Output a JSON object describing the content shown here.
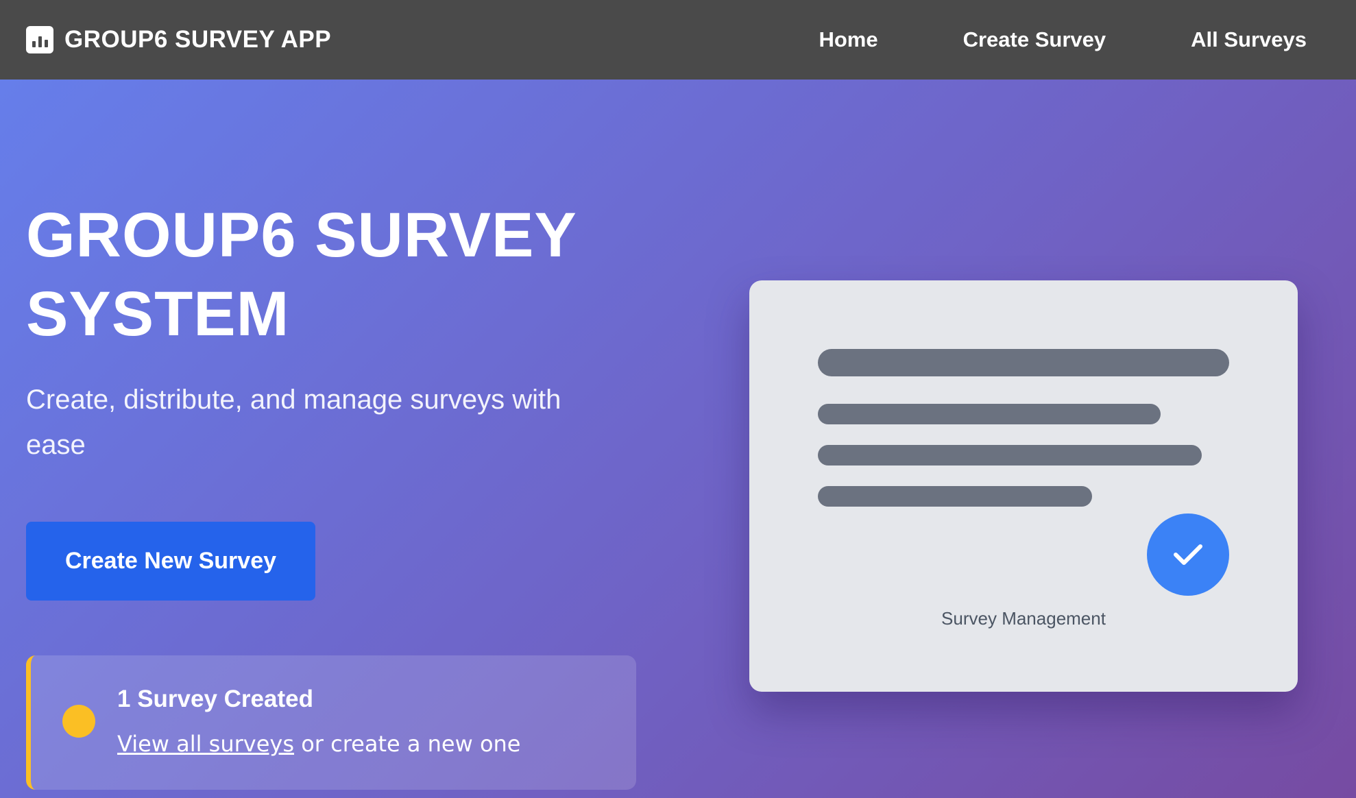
{
  "navbar": {
    "brand_icon": "bar-chart-icon",
    "brand_title": "GROUP6 SURVEY APP",
    "links": [
      {
        "label": "Home"
      },
      {
        "label": "Create Survey"
      },
      {
        "label": "All Surveys"
      }
    ]
  },
  "hero": {
    "title": "GROUP6 SURVEY SYSTEM",
    "subtitle": "Create, distribute, and manage surveys with ease",
    "cta_label": "Create New Survey"
  },
  "stats": {
    "title": "1 Survey Created",
    "link_text": "View all surveys",
    "suffix_text": " or create a new one"
  },
  "illustration": {
    "caption": "Survey Management",
    "icon": "checkmark-icon"
  },
  "colors": {
    "navbar_bg": "#4a4a4a",
    "gradient_start": "#667eea",
    "gradient_end": "#764ba2",
    "button": "#2563eb",
    "accent": "#fbbf24",
    "check": "#3b82f6"
  }
}
